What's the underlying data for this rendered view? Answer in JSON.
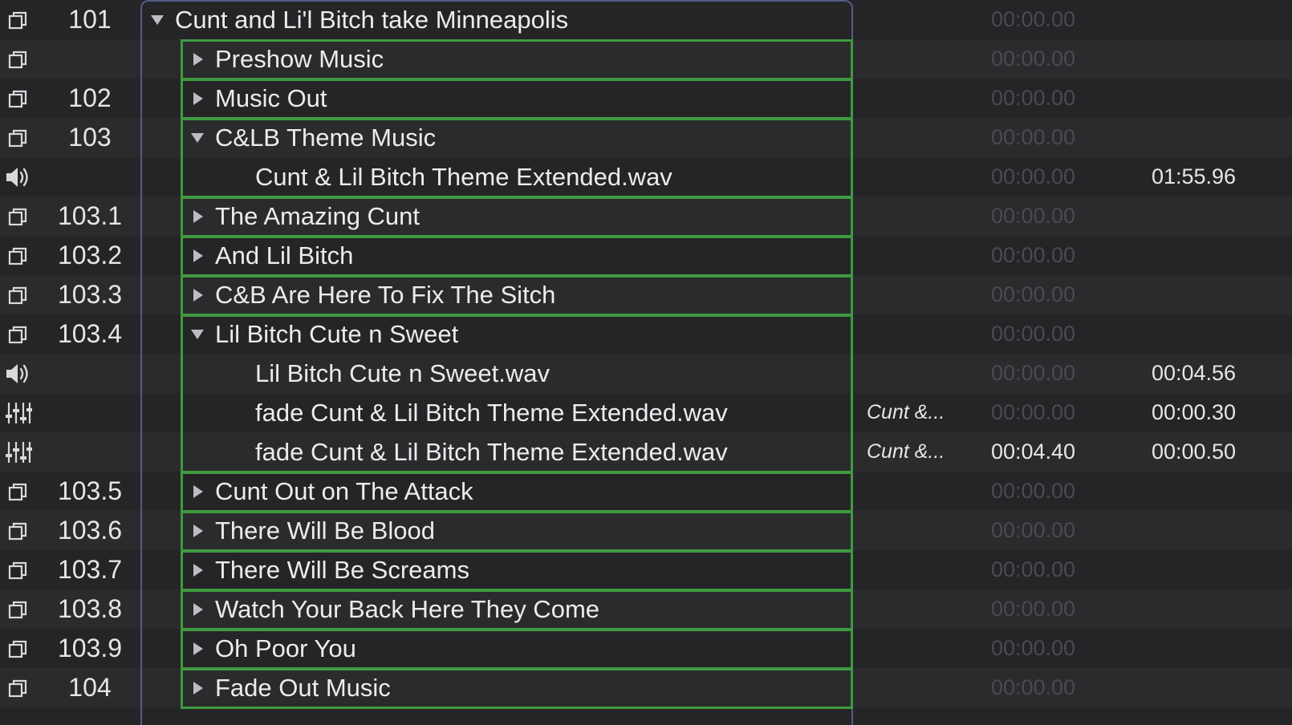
{
  "rows": [
    {
      "number": "101",
      "name": "Cunt and Li'l Bitch take Minneapolis",
      "icon": "group-cue-icon",
      "disclosure": "expanded",
      "indent": 0,
      "target": "",
      "prewait": "00:00.00",
      "duration": ""
    },
    {
      "number": "",
      "name": "Preshow Music",
      "icon": "group-cue-icon",
      "disclosure": "collapsed",
      "indent": 1,
      "target": "",
      "prewait": "00:00.00",
      "duration": ""
    },
    {
      "number": "102",
      "name": "Music Out",
      "icon": "group-cue-icon",
      "disclosure": "collapsed",
      "indent": 1,
      "target": "",
      "prewait": "00:00.00",
      "duration": ""
    },
    {
      "number": "103",
      "name": "C&LB Theme Music",
      "icon": "group-cue-icon",
      "disclosure": "expanded",
      "indent": 1,
      "target": "",
      "prewait": "00:00.00",
      "duration": ""
    },
    {
      "number": "",
      "name": "Cunt & Lil Bitch Theme Extended.wav",
      "icon": "speaker-icon",
      "disclosure": "none",
      "indent": 2,
      "target": "",
      "prewait": "00:00.00",
      "duration": "01:55.96"
    },
    {
      "number": "103.1",
      "name": "The Amazing Cunt",
      "icon": "group-cue-icon",
      "disclosure": "collapsed",
      "indent": 1,
      "target": "",
      "prewait": "00:00.00",
      "duration": ""
    },
    {
      "number": "103.2",
      "name": "And Lil Bitch",
      "icon": "group-cue-icon",
      "disclosure": "collapsed",
      "indent": 1,
      "target": "",
      "prewait": "00:00.00",
      "duration": ""
    },
    {
      "number": "103.3",
      "name": "C&B Are Here To Fix The Sitch",
      "icon": "group-cue-icon",
      "disclosure": "collapsed",
      "indent": 1,
      "target": "",
      "prewait": "00:00.00",
      "duration": ""
    },
    {
      "number": "103.4",
      "name": "Lil Bitch Cute n Sweet",
      "icon": "group-cue-icon",
      "disclosure": "expanded",
      "indent": 1,
      "target": "",
      "prewait": "00:00.00",
      "duration": ""
    },
    {
      "number": "",
      "name": "Lil Bitch Cute n Sweet.wav",
      "icon": "speaker-icon",
      "disclosure": "none",
      "indent": 2,
      "target": "",
      "prewait": "00:00.00",
      "duration": "00:04.56"
    },
    {
      "number": "",
      "name": "fade Cunt & Lil Bitch Theme Extended.wav",
      "icon": "fader-icon",
      "disclosure": "none",
      "indent": 2,
      "target": "Cunt &...",
      "prewait": "00:00.00",
      "duration": "00:00.30"
    },
    {
      "number": "",
      "name": "fade Cunt & Lil Bitch Theme Extended.wav",
      "icon": "fader-icon",
      "disclosure": "none",
      "indent": 2,
      "target": "Cunt &...",
      "prewait": "00:04.40",
      "prewait_active": true,
      "duration": "00:00.50"
    },
    {
      "number": "103.5",
      "name": "Cunt Out on The Attack",
      "icon": "group-cue-icon",
      "disclosure": "collapsed",
      "indent": 1,
      "target": "",
      "prewait": "00:00.00",
      "duration": ""
    },
    {
      "number": "103.6",
      "name": "There Will Be Blood",
      "icon": "group-cue-icon",
      "disclosure": "collapsed",
      "indent": 1,
      "target": "",
      "prewait": "00:00.00",
      "duration": ""
    },
    {
      "number": "103.7",
      "name": "There Will Be Screams",
      "icon": "group-cue-icon",
      "disclosure": "collapsed",
      "indent": 1,
      "target": "",
      "prewait": "00:00.00",
      "duration": ""
    },
    {
      "number": "103.8",
      "name": "Watch Your Back Here They Come",
      "icon": "group-cue-icon",
      "disclosure": "collapsed",
      "indent": 1,
      "target": "",
      "prewait": "00:00.00",
      "duration": ""
    },
    {
      "number": "103.9",
      "name": "Oh Poor You",
      "icon": "group-cue-icon",
      "disclosure": "collapsed",
      "indent": 1,
      "target": "",
      "prewait": "00:00.00",
      "duration": ""
    },
    {
      "number": "104",
      "name": "Fade Out Music",
      "icon": "group-cue-icon",
      "disclosure": "collapsed",
      "indent": 1,
      "target": "",
      "prewait": "00:00.00",
      "duration": ""
    }
  ],
  "colors": {
    "background": "#252528",
    "row_alt": "#2b2b2e",
    "text": "#e6e6e8",
    "dim_time": "#4a4a4f",
    "group_outline_outer": "#565a86",
    "group_outline_inner": "#3f9a3f"
  }
}
